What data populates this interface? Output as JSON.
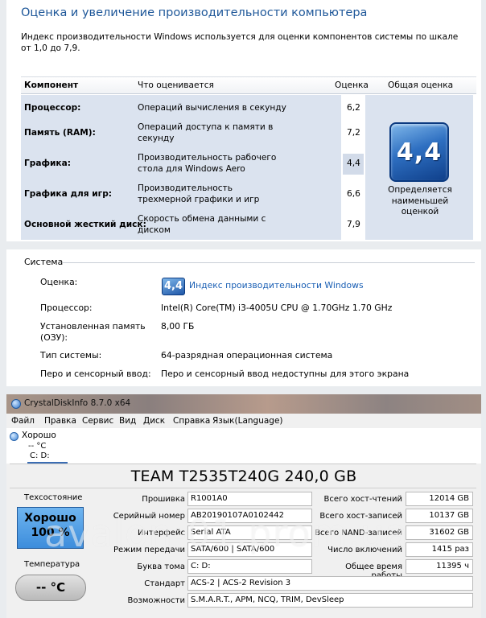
{
  "wei": {
    "title": "Оценка и увеличение производительности компьютера",
    "intro": "Индекс производительности Windows используется для оценки компонентов системы по шкале от 1,0 до 7,9.",
    "headers": {
      "component": "Компонент",
      "what": "Что оценивается",
      "score": "Оценка",
      "overall": "Общая оценка"
    },
    "rows": [
      {
        "component": "Процессор:",
        "what": "Операций вычисления в секунду",
        "score": "6,2"
      },
      {
        "component": "Память (RAM):",
        "what": "Операций доступа к памяти в секунду",
        "score": "7,2"
      },
      {
        "component": "Графика:",
        "what": "Производительность рабочего стола для Windows Aero",
        "score": "4,4"
      },
      {
        "component": "Графика для игр:",
        "what": "Производительность трехмерной графики и игр",
        "score": "6,6"
      },
      {
        "component": "Основной жесткий диск:",
        "what": "Скорость обмена данными с диском",
        "score": "7,9"
      }
    ],
    "overall_value": "4,4",
    "overall_caption": "Определяется наименьшей оценкой",
    "colors": {
      "title": "#1e5799",
      "badge": "#2e6fc1",
      "row_bg": "#dbe3ef"
    }
  },
  "system": {
    "group_title": "Система",
    "rows": [
      {
        "label": "Оценка:",
        "value": ""
      },
      {
        "label": "Процессор:",
        "value": "Intel(R) Core(TM) i3-4005U CPU @ 1.70GHz   1.70 GHz"
      },
      {
        "label": "Установленная память (ОЗУ):",
        "value": "8,00 ГБ"
      },
      {
        "label": "Тип системы:",
        "value": "64-разрядная операционная система"
      },
      {
        "label": "Перо и сенсорный ввод:",
        "value": "Перо и сенсорный ввод недоступны для этого экрана"
      }
    ],
    "mini_badge": "4,4",
    "wei_link": "Индекс производительности Windows"
  },
  "cdi": {
    "window_title": "CrystalDiskInfo 8.7.0 x64",
    "menu": [
      "Файл",
      "Правка",
      "Сервис",
      "Вид",
      "Диск",
      "Справка",
      "Язык(Language)"
    ],
    "status_text": "Хорошо",
    "status_temp": "-- °C",
    "status_drive": "C: D:",
    "disk_title": "TEAM T2535T240G 240,0 GB",
    "health_label": "Техсостояние",
    "health_status": "Хорошо",
    "health_percent": "100 %",
    "temp_label": "Температура",
    "temp_value": "-- °C",
    "left_fields": [
      {
        "label": "Прошивка",
        "value": "R1001A0"
      },
      {
        "label": "Серийный номер",
        "value": "AB20190107A0102442"
      },
      {
        "label": "Интерфейс",
        "value": "Serial ATA"
      },
      {
        "label": "Режим передачи",
        "value": "SATA/600 | SATA/600"
      },
      {
        "label": "Буква тома",
        "value": "C: D:"
      }
    ],
    "right_fields": [
      {
        "label": "Всего хост-чтений",
        "value": "12014 GB"
      },
      {
        "label": "Всего хост-записей",
        "value": "10137 GB"
      },
      {
        "label": "Всего NAND-записей",
        "value": "31602 GB"
      },
      {
        "label": "Число включений",
        "value": "1415 раз"
      },
      {
        "label": "Общее время работы",
        "value": "11395 ч"
      }
    ],
    "standard_label": "Стандарт",
    "standard_value": "ACS-2 | ACS-2 Revision 3",
    "features_label": "Возможности",
    "features_value": "S.M.A.R.T., APM, NCQ, TRIM, DevSleep",
    "colors": {
      "health": "#3d8ddc",
      "status_dot": "#3b82d6"
    }
  },
  "watermark": "avalon-01.prom.ua"
}
